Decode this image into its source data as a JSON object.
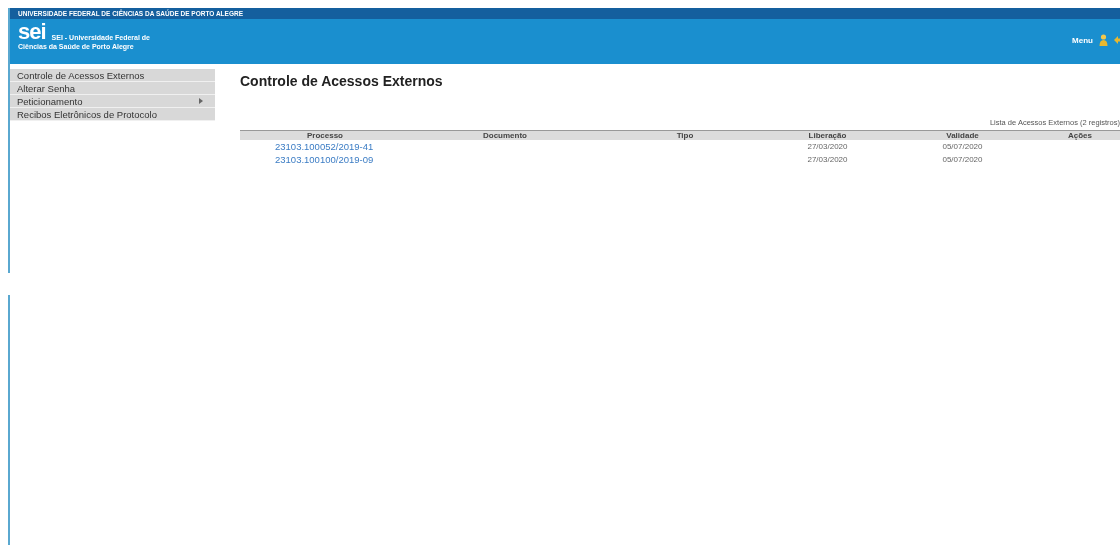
{
  "header": {
    "institution": "UNIVERSIDADE FEDERAL DE CIÊNCIAS DA SAÚDE DE PORTO ALEGRE",
    "logo": "sei",
    "system_title_line1": "SEI - Universidade Federal de",
    "system_title_line2": "Ciências da Saúde de Porto Alegre",
    "menu_label": "Menu"
  },
  "sidebar": {
    "items": [
      {
        "label": "Controle de Acessos Externos",
        "has_submenu": false
      },
      {
        "label": "Alterar Senha",
        "has_submenu": false
      },
      {
        "label": "Peticionamento",
        "has_submenu": true
      },
      {
        "label": "Recibos Eletrônicos de Protocolo",
        "has_submenu": false
      }
    ]
  },
  "page_title": "Controle de Acessos Externos",
  "table": {
    "caption": "Lista de Acessos Externos (2 registros)",
    "columns": [
      "Processo",
      "Documento",
      "Tipo",
      "Liberação",
      "Validade",
      "Ações"
    ],
    "rows": [
      {
        "processo": "23103.100052/2019-41",
        "liberacao": "27/03/2020",
        "validade": "05/07/2020"
      },
      {
        "processo": "23103.100100/2019-09",
        "liberacao": "27/03/2020",
        "validade": "05/07/2020"
      }
    ]
  }
}
